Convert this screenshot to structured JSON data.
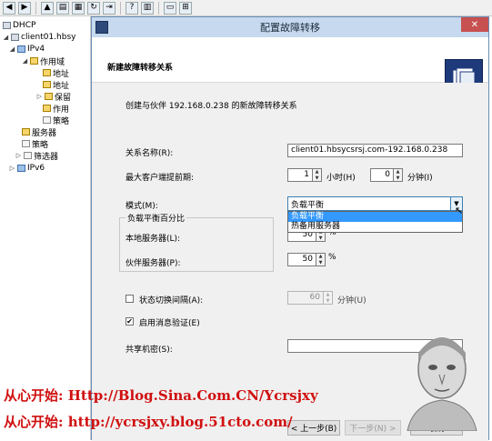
{
  "toolbar": {
    "icons": [
      "back-icon",
      "forward-icon",
      "up-folder-icon",
      "show-tree-icon",
      "console-icon",
      "refresh-icon",
      "export-icon",
      "help-icon",
      "properties-icon",
      "monitor-icon",
      "network-icon"
    ]
  },
  "tree": {
    "items": [
      {
        "label": "DHCP",
        "icon": "dhcp-icon"
      },
      {
        "label": "client01.hbsy",
        "icon": "server-icon"
      },
      {
        "label": "IPv4",
        "icon": "ipv4-icon"
      },
      {
        "label": "作用域",
        "icon": "folder-icon"
      },
      {
        "label": "地址",
        "icon": "folder-icon"
      },
      {
        "label": "地址",
        "icon": "folder-icon"
      },
      {
        "label": "保留",
        "icon": "folder-icon"
      },
      {
        "label": "作用",
        "icon": "folder-icon"
      },
      {
        "label": "策略",
        "icon": "folder-icon"
      },
      {
        "label": "服务器",
        "icon": "folder-icon"
      },
      {
        "label": "策略",
        "icon": "folder-icon"
      },
      {
        "label": "筛选器",
        "icon": "folder-icon"
      },
      {
        "label": "IPv6",
        "icon": "ipv6-icon"
      }
    ]
  },
  "dialog": {
    "title": "配置故障转移",
    "close_label": "✕",
    "header_title": "新建故障转移关系",
    "intro": "创建与伙伴 192.168.0.238 的新故障转移关系",
    "relationship_name_label": "关系名称(R):",
    "relationship_name_value": "client01.hbsycsrsj.com-192.168.0.238",
    "mclt_label": "最大客户端提前期:",
    "mclt_hours_value": "1",
    "hours_label": "小时(H)",
    "mclt_minutes_value": "0",
    "minutes_label": "分钟(I)",
    "mode_label": "模式(M):",
    "mode_value": "负载平衡",
    "mode_options": [
      "负载平衡",
      "热备用服务器"
    ],
    "lb_group_label": "负载平衡百分比",
    "local_server_label": "本地服务器(L):",
    "local_server_value": "50",
    "partner_server_label": "伙伴服务器(P):",
    "partner_server_value": "50",
    "percent_symbol": "%",
    "state_switch_label": "状态切换间隔(A):",
    "state_switch_value": "60",
    "state_switch_unit": "分钟(U)",
    "auth_label": "启用消息验证(E)",
    "auth_checked": "✔",
    "shared_secret_label": "共享机密(S):",
    "back_button": "< 上一步(B)",
    "next_button": "下一步(N) >",
    "cancel_button": "取消"
  },
  "watermark": {
    "line1": "从心开始: Http://Blog.Sina.Com.CN/Ycrsjxy",
    "line2": "从心开始: http://ycrsjxy.blog.51cto.com/",
    "color": "#d01010"
  }
}
